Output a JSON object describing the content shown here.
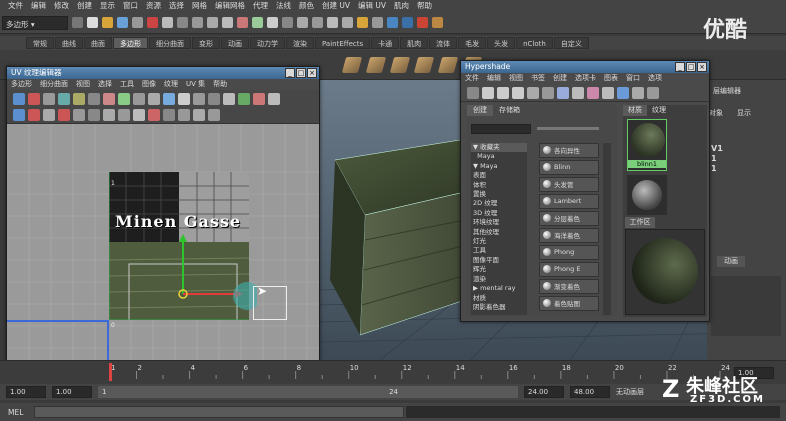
{
  "main_menu": [
    "文件",
    "编辑",
    "修改",
    "创建",
    "显示",
    "窗口",
    "资源",
    "选择",
    "网格",
    "编辑网格",
    "代理",
    "法线",
    "颜色",
    "创建 UV",
    "编辑 UV",
    "肌肉",
    "帮助"
  ],
  "status": {
    "mode": "多边形"
  },
  "shelf_tabs": [
    "常规",
    "曲线",
    "曲面",
    "多边形",
    "细分曲面",
    "变形",
    "动画",
    "动力学",
    "渲染",
    "PaintEffects",
    "卡通",
    "肌肉",
    "流体",
    "毛发",
    "头发",
    "nCloth",
    "自定义"
  ],
  "shelf_active": "多边形",
  "uv_editor": {
    "title": "UV 纹理编辑器",
    "menu": [
      "多边形",
      "细分曲面",
      "视图",
      "选择",
      "工具",
      "图像",
      "纹理",
      "UV 集",
      "帮助"
    ],
    "texture_text": "Minen Gasse",
    "axis_0": "0",
    "axis_1": "1"
  },
  "hypershade": {
    "title": "Hypershade",
    "menu": [
      "文件",
      "编辑",
      "视图",
      "书签",
      "创建",
      "选项卡",
      "图表",
      "窗口",
      "选项"
    ],
    "tabs_left": [
      "创建",
      "存储箱"
    ],
    "tree": [
      "▼ 收藏夹",
      "  Maya",
      "▼ Maya",
      "表面",
      "体积",
      "置换",
      "2D 纹理",
      "3D 纹理",
      "环境纹理",
      "其他纹理",
      "灯光",
      "工具",
      "图像平面",
      "辉光",
      "渲染",
      "▶ mental ray",
      "材质",
      "阴影着色器"
    ],
    "materials": [
      "各向异性",
      "Blinn",
      "头发管",
      "Lambert",
      "分层着色",
      "海洋着色",
      "Phong",
      "Phong E",
      "渐变着色",
      "着色贴图"
    ],
    "tabs_right": [
      "材质",
      "纹理"
    ],
    "swatch_label": "blinn1",
    "work_tab": "工作区"
  },
  "right_panel": {
    "items": [
      "层编辑器",
      "对象",
      "显示",
      "V1",
      "1",
      "1",
      "动画"
    ]
  },
  "timeline": {
    "ticks": [
      "1",
      "2",
      "4",
      "6",
      "8",
      "10",
      "12",
      "14",
      "16",
      "18",
      "20",
      "22",
      "24"
    ],
    "current_frame": "1.00"
  },
  "range": {
    "start": "1.00",
    "start2": "1.00",
    "field": "1",
    "end_mark": "24",
    "end1": "24.00",
    "end2": "48.00",
    "label": "无动画层"
  },
  "mel_label": "MEL",
  "watermarks": {
    "top_right": "优酷",
    "bottom_right": "朱峰社区",
    "bottom_right_sub": "ZF3D.COM"
  }
}
